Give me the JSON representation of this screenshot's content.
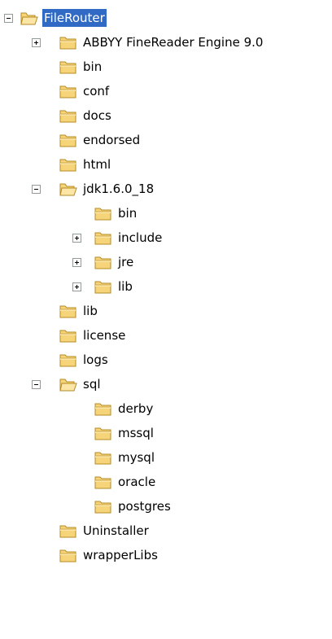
{
  "tree": {
    "colors": {
      "selection_bg": "#316ac5",
      "selection_fg": "#ffffff",
      "folder_fill": "#f6d479",
      "folder_edge": "#b58a25"
    },
    "nodes": [
      {
        "label": "FileRouter",
        "level": 0,
        "expander": "minus",
        "open": true,
        "selected": true
      },
      {
        "label": "ABBYY FineReader Engine 9.0",
        "level": 1,
        "expander": "plus",
        "open": false
      },
      {
        "label": "bin",
        "level": 1,
        "expander": "none",
        "open": false
      },
      {
        "label": "conf",
        "level": 1,
        "expander": "none",
        "open": false
      },
      {
        "label": "docs",
        "level": 1,
        "expander": "none",
        "open": false
      },
      {
        "label": "endorsed",
        "level": 1,
        "expander": "none",
        "open": false
      },
      {
        "label": "html",
        "level": 1,
        "expander": "none",
        "open": false
      },
      {
        "label": "jdk1.6.0_18",
        "level": 1,
        "expander": "minus",
        "open": true
      },
      {
        "label": "bin",
        "level": 2,
        "expander": "none",
        "open": false
      },
      {
        "label": "include",
        "level": 2,
        "expander": "plus",
        "open": false
      },
      {
        "label": "jre",
        "level": 2,
        "expander": "plus",
        "open": false
      },
      {
        "label": "lib",
        "level": 2,
        "expander": "plus",
        "open": false
      },
      {
        "label": "lib",
        "level": 1,
        "expander": "none",
        "open": false
      },
      {
        "label": "license",
        "level": 1,
        "expander": "none",
        "open": false
      },
      {
        "label": "logs",
        "level": 1,
        "expander": "none",
        "open": false
      },
      {
        "label": "sql",
        "level": 1,
        "expander": "minus",
        "open": true
      },
      {
        "label": "derby",
        "level": 2,
        "expander": "none",
        "open": false
      },
      {
        "label": "mssql",
        "level": 2,
        "expander": "none",
        "open": false
      },
      {
        "label": "mysql",
        "level": 2,
        "expander": "none",
        "open": false
      },
      {
        "label": "oracle",
        "level": 2,
        "expander": "none",
        "open": false
      },
      {
        "label": "postgres",
        "level": 2,
        "expander": "none",
        "open": false
      },
      {
        "label": "Uninstaller",
        "level": 1,
        "expander": "none",
        "open": false
      },
      {
        "label": "wrapperLibs",
        "level": 1,
        "expander": "none",
        "open": false
      }
    ]
  }
}
